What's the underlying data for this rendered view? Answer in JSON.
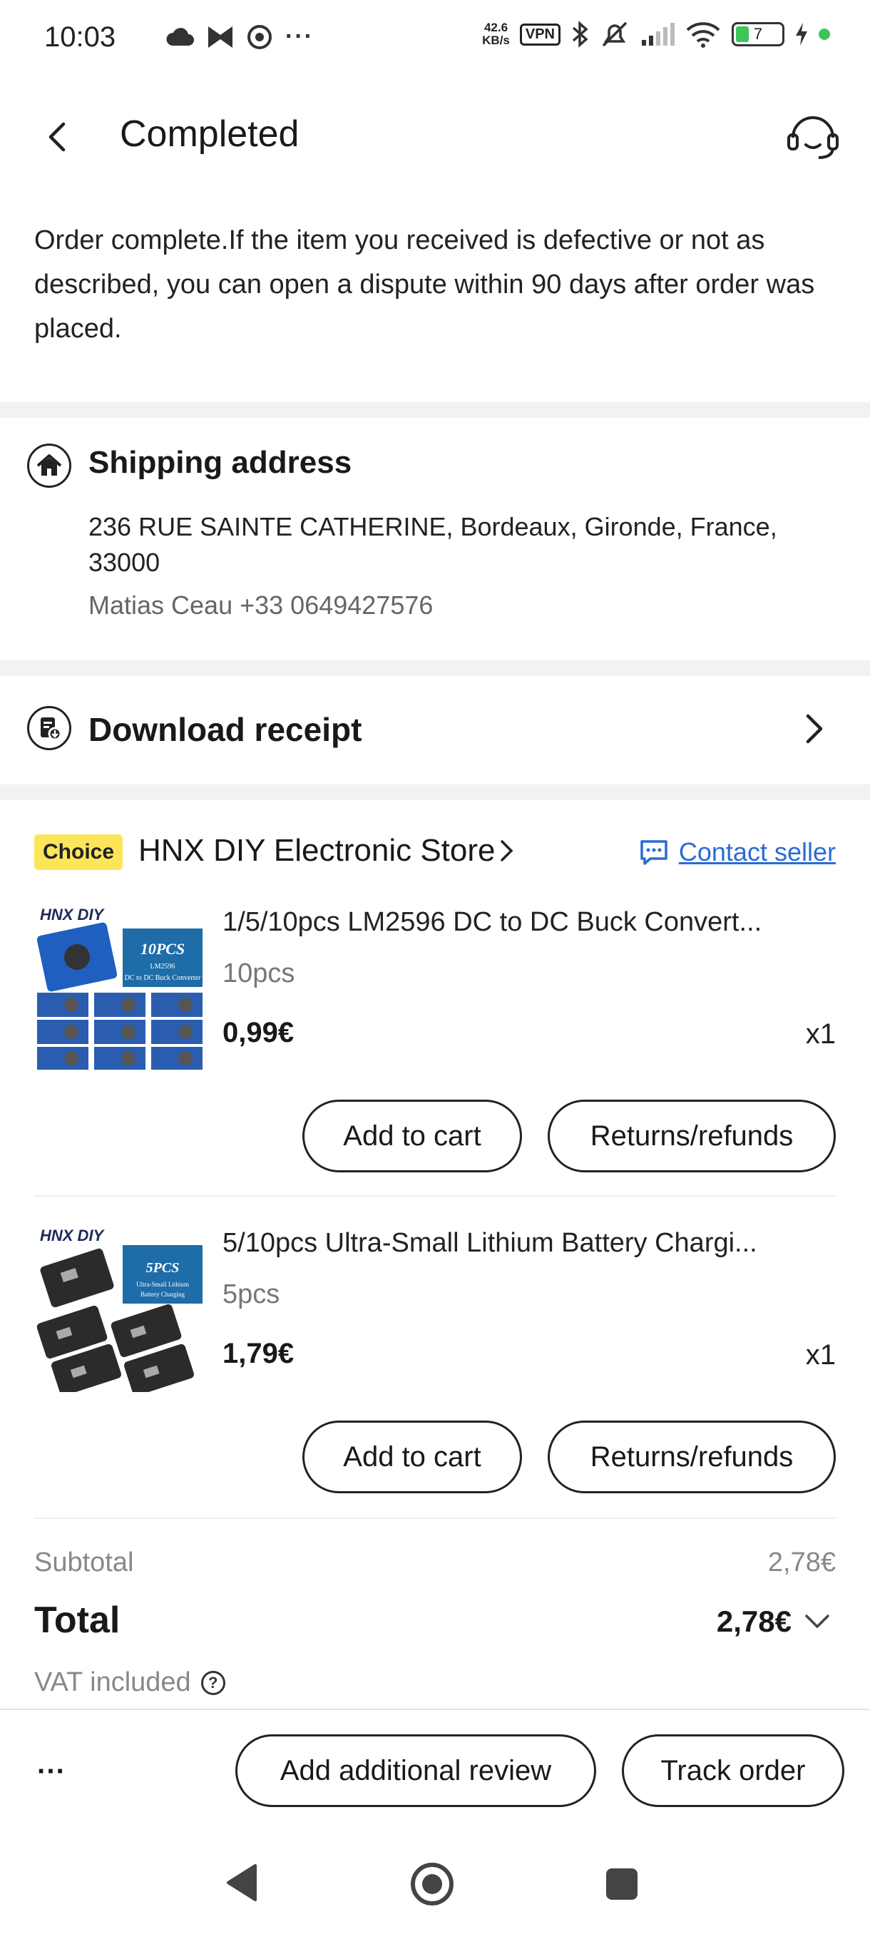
{
  "status_bar": {
    "time": "10:03",
    "more": "···",
    "net_speed_value": "42.6",
    "net_speed_unit": "KB/s",
    "vpn": "VPN",
    "battery_level": "7",
    "battery_fill": 0.07
  },
  "header": {
    "title": "Completed"
  },
  "notice": {
    "text": "Order complete.If the item you received is defective or not as described, you can open a dispute within 90 days after order was placed."
  },
  "shipping": {
    "title": "Shipping address",
    "address": "236 RUE SAINTE CATHERINE, Bordeaux, Gironde, France, 33000",
    "contact": "Matias Ceau +33 0649427576"
  },
  "receipt": {
    "label": "Download receipt"
  },
  "store": {
    "badge": "Choice",
    "name": "HNX DIY Electronic Store",
    "contact_label": "Contact seller"
  },
  "products": [
    {
      "name": "1/5/10pcs LM2596 DC to DC Buck Convert...",
      "variant": "10pcs",
      "price": "0,99€",
      "qty": "x1",
      "thumb_brand": "HNX DIY",
      "thumb_badge": "10PCS",
      "thumb_sub1": "LM2596",
      "thumb_sub2": "DC to DC Buck Converter",
      "add_label": "Add to cart",
      "returns_label": "Returns/refunds"
    },
    {
      "name": "5/10pcs Ultra-Small Lithium Battery Chargi...",
      "variant": "5pcs",
      "price": "1,79€",
      "qty": "x1",
      "thumb_brand": "HNX DIY",
      "thumb_badge": "5PCS",
      "thumb_sub1": "Ultra-Small Lithium",
      "thumb_sub2": "Battery Charging",
      "add_label": "Add to cart",
      "returns_label": "Returns/refunds"
    }
  ],
  "summary": {
    "subtotal_label": "Subtotal",
    "subtotal_value": "2,78€",
    "total_label": "Total",
    "total_value": "2,78€",
    "vat_label": "VAT included",
    "help": "?"
  },
  "actions": {
    "more": "···",
    "review_label": "Add additional review",
    "track_label": "Track order"
  },
  "colors": {
    "accent_link": "#2a6bd6",
    "choice_badge": "#fde55a",
    "battery_green": "#3ec55a"
  }
}
